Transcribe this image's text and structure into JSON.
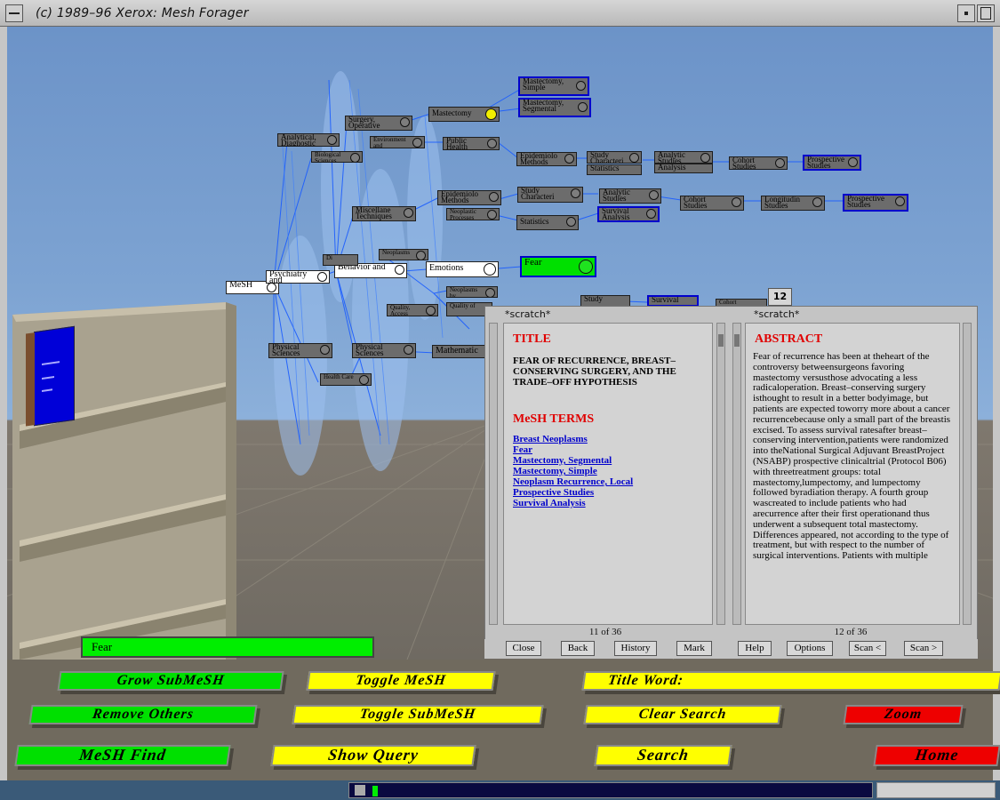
{
  "window": {
    "title": "(c) 1989–96 Xerox:   Mesh Forager"
  },
  "tree": {
    "nodes": [
      {
        "id": "mesh",
        "label": "MeSH"
      },
      {
        "id": "psych",
        "label": "Psychiatry and"
      },
      {
        "id": "behavior",
        "label": "Behavior and"
      },
      {
        "id": "emotions",
        "label": "Emotions"
      },
      {
        "id": "fear",
        "label": "Fear"
      },
      {
        "id": "analytical",
        "label": "Analytical, Diagnostic"
      },
      {
        "id": "biological",
        "label": "Biological Sciences"
      },
      {
        "id": "surgery",
        "label": "Surgery, Operative"
      },
      {
        "id": "environment",
        "label": "Environment and"
      },
      {
        "id": "mastectomy",
        "label": "Mastectomy"
      },
      {
        "id": "mast_simple",
        "label": "Mastectomy, Simple"
      },
      {
        "id": "mast_seg",
        "label": "Mastectomy, Segmental"
      },
      {
        "id": "public_health",
        "label": "Public Health"
      },
      {
        "id": "epid1",
        "label": "Epidemiolo Methods"
      },
      {
        "id": "study_char1",
        "label": "Study Characteri"
      },
      {
        "id": "statistics1",
        "label": "Statistics"
      },
      {
        "id": "analytic1",
        "label": "Analytic Studies"
      },
      {
        "id": "analysis1",
        "label": "Analysis"
      },
      {
        "id": "cohort1",
        "label": "Cohort Studies"
      },
      {
        "id": "prosp1",
        "label": "Prospective Studies"
      },
      {
        "id": "misc",
        "label": "Miscellane Techniques"
      },
      {
        "id": "epid2",
        "label": "Epidemiolo Methods"
      },
      {
        "id": "neoplastic",
        "label": "Neoplastic Processes"
      },
      {
        "id": "study_char2",
        "label": "Study Characteri"
      },
      {
        "id": "analytic2",
        "label": "Analytic Studies"
      },
      {
        "id": "cohort2",
        "label": "Cohort Studies"
      },
      {
        "id": "longit",
        "label": "Longitudin Studies"
      },
      {
        "id": "prosp2",
        "label": "Prospective Studies"
      },
      {
        "id": "statistics2",
        "label": "Statistics"
      },
      {
        "id": "survival",
        "label": "Survival Analysis"
      },
      {
        "id": "neoplasms",
        "label": "Neoplasms"
      },
      {
        "id": "di",
        "label": "Di"
      },
      {
        "id": "neoplasms_by",
        "label": "Neoplasms by"
      },
      {
        "id": "quality1",
        "label": "Quality, Access"
      },
      {
        "id": "quality2",
        "label": "Quality of"
      },
      {
        "id": "study3",
        "label": "Study"
      },
      {
        "id": "survival2",
        "label": "Survival"
      },
      {
        "id": "cohort3",
        "label": "Cohort"
      },
      {
        "id": "physical1",
        "label": "Physical Sciences"
      },
      {
        "id": "physical2",
        "label": "Physical Sciences"
      },
      {
        "id": "health",
        "label": "Health Care"
      },
      {
        "id": "mathematic",
        "label": "Mathematic"
      }
    ]
  },
  "book": {
    "tab_number": "12",
    "left_page": {
      "header": "*scratch*",
      "title_heading": "TITLE",
      "title_text": "FEAR OF RECURRENCE, BREAST–CONSERVING SURGERY, AND THE TRADE–OFF HYPOTHESIS",
      "mesh_heading": "MeSH TERMS",
      "mesh_terms": [
        "Breast Neoplasms",
        "Fear",
        "Mastectomy, Segmental",
        "Mastectomy, Simple",
        "Neoplasm Recurrence, Local",
        "Prospective Studies",
        "Survival Analysis"
      ],
      "page_number": "11 of 36"
    },
    "right_page": {
      "header": "*scratch*",
      "abstract_heading": "ABSTRACT",
      "abstract_text": "Fear of recurrence has been at theheart of the controversy betweensurgeons favoring mastectomy versusthose advocating a less radicaloperation. Breast–conserving surgery isthought to result in a better bodyimage, but patients are expected toworry more about a cancer recurrencebecause only a small part of the breastis excised. To assess survival ratesafter breast–conserving intervention,patients were randomized into theNational Surgical Adjuvant BreastProject (NSABP) prospective clinicaltrial (Protocol B06) with threetreatment groups: total mastectomy,lumpectomy, and lumpectomy followed byradiation therapy. A fourth group wascreated to include patients who had arecurrence after their first operationand thus underwent a subsequent total mastectomy. Differences appeared, not according to the type of treatment, but with respect to the number of surgical interventions. Patients with multiple",
      "page_number": "12 of 36"
    },
    "buttons": [
      "Close",
      "Back",
      "History",
      "Mark",
      "Help",
      "Options",
      "Scan <",
      "Scan >"
    ]
  },
  "search_field": {
    "value": "Fear"
  },
  "controls": {
    "grow_submesh": "Grow SubMeSH",
    "remove_others": "Remove Others",
    "mesh_find": "MeSH Find",
    "toggle_mesh": "Toggle MeSH",
    "toggle_submesh": "Toggle SubMeSH",
    "show_query": "Show Query",
    "title_word": "Title Word:",
    "clear_search": "Clear Search",
    "search": "Search",
    "zoom": "Zoom",
    "home": "Home"
  },
  "colors": {
    "green": "#00e000",
    "yellow": "#ffff00",
    "red": "#ee0000",
    "link_blue": "#0000cc",
    "heading_red": "#e00000"
  }
}
